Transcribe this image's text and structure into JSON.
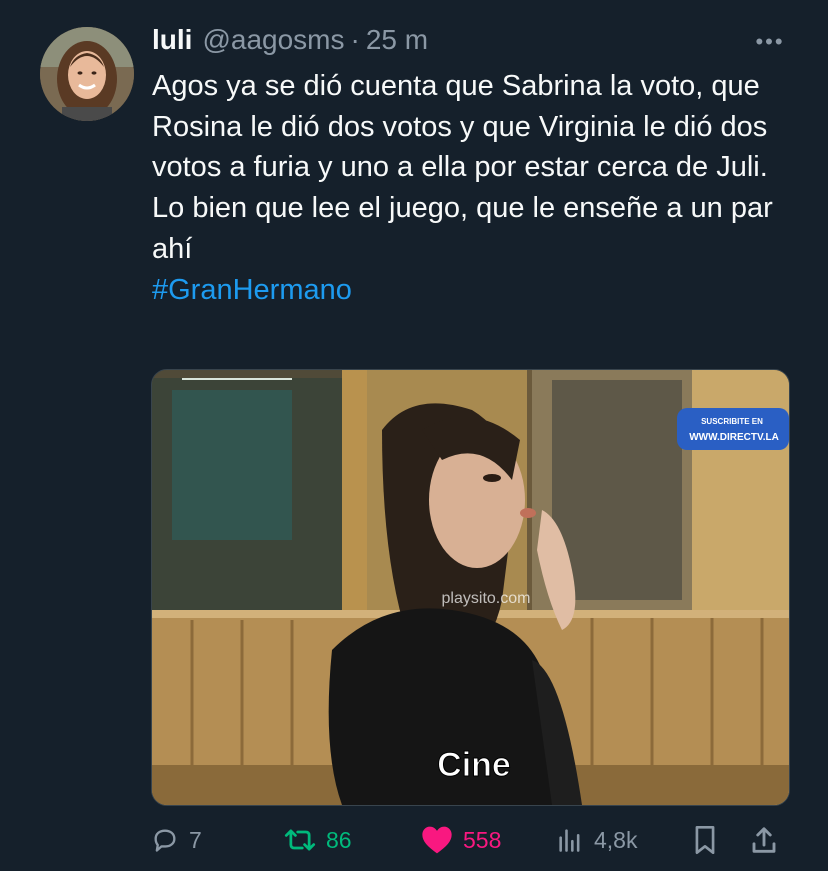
{
  "tweet": {
    "author_name": "luli",
    "author_handle": "@aagosms",
    "separator": "·",
    "time": "25 m",
    "more_label": "•••",
    "text_lines": [
      "Agos ya se dió cuenta que Sabrina la voto, que Rosina le dió dos votos y que Virginia le dió dos votos a furia y uno a ella por estar cerca de Juli.",
      "Lo bien que lee el juego, que le enseñe a un par ahí"
    ],
    "hashtag": "#GranHermano"
  },
  "media": {
    "watermark": "playsito.com",
    "tv_badge_line1": "SUSCRIBITE EN",
    "tv_badge_line2": "WWW.DIRECTV.LA",
    "caption": "Cine"
  },
  "actions": {
    "replies": "7",
    "retweets": "86",
    "likes": "558",
    "views": "4,8k"
  },
  "colors": {
    "background": "#15202b",
    "text": "#f7f9f9",
    "secondary": "#8b98a5",
    "link": "#1d9bf0",
    "retweet": "#00ba7c",
    "like": "#f91880"
  }
}
